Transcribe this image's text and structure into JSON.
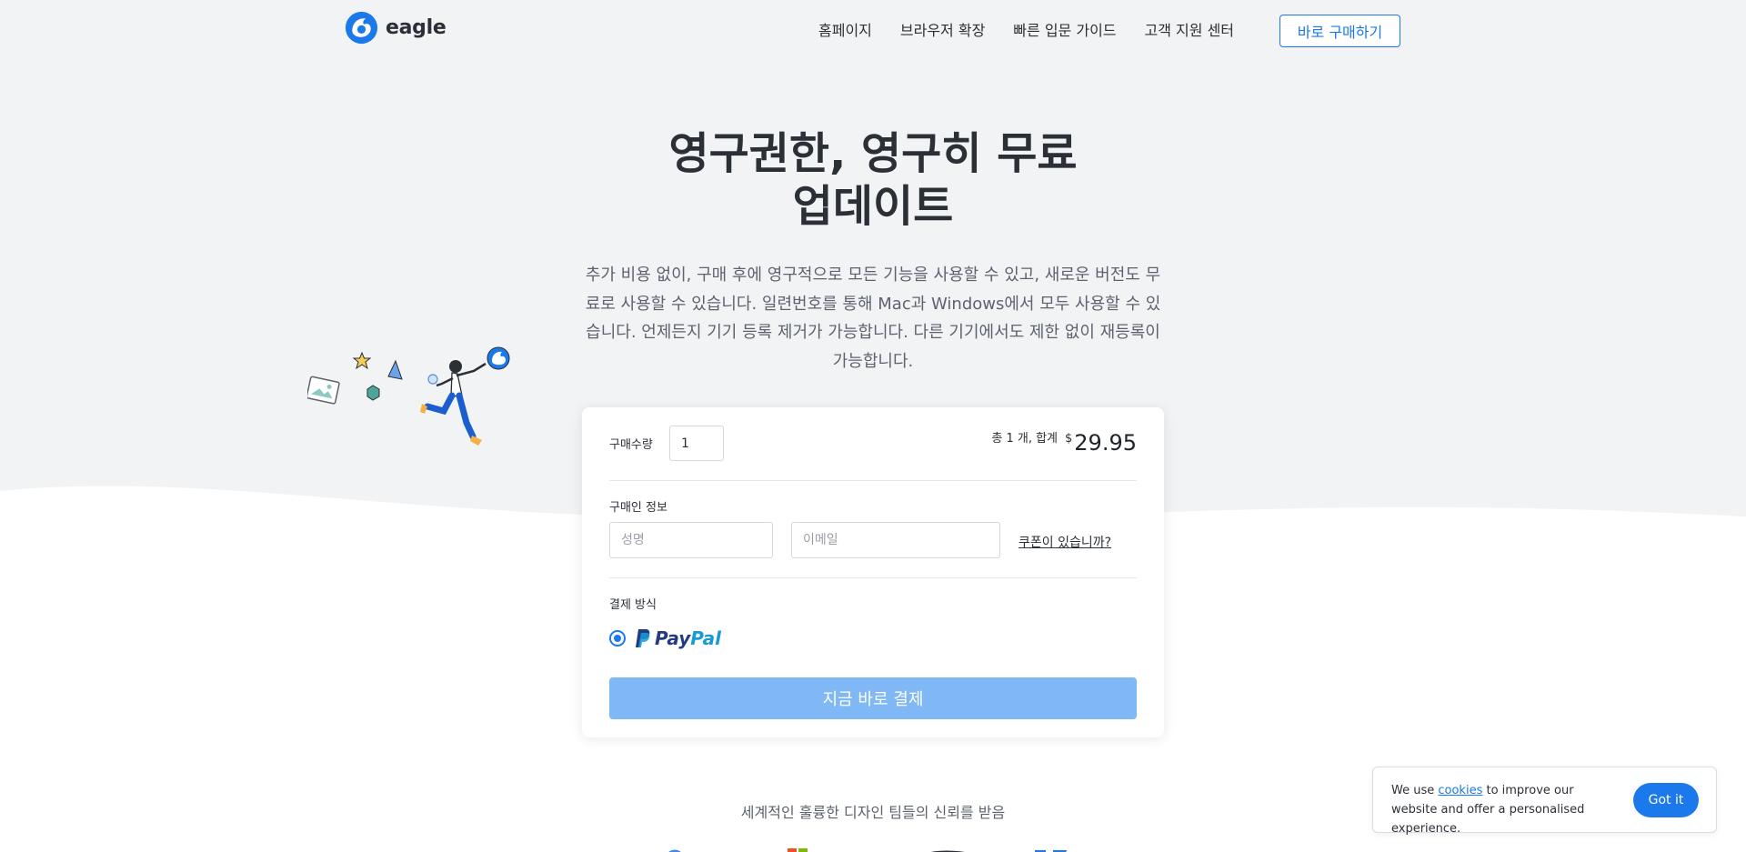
{
  "header": {
    "logo_text": "eagle",
    "nav": [
      "홈페이지",
      "브라우저 확장",
      "빠른 입문 가이드",
      "고객 지원 센터"
    ],
    "buy_button": "바로 구매하기"
  },
  "hero": {
    "title_line1": "영구권한, 영구히 무료",
    "title_line2": "업데이트",
    "subtitle": "추가 비용 없이, 구매 후에 영구적으로 모든 기능을 사용할 수 있고, 새로운 버전도 무료로 사용할 수 있습니다. 일련번호를 통해 Mac과 Windows에서 모두 사용할 수 있습니다. 언제든지 기기 등록 제거가 가능합니다. 다른 기기에서도 제한 없이 재등록이 가능합니다."
  },
  "purchase": {
    "quantity_label": "구매수량",
    "quantity_value": "1",
    "summary_text": "총 1 개, 합계",
    "currency": "$",
    "total": "29.95",
    "buyer_label": "구매인 정보",
    "name_placeholder": "성명",
    "email_placeholder": "이메일",
    "coupon_link": "쿠폰이 있습니까?",
    "payment_label": "결제 방식",
    "payment_option_pay": "Pay",
    "payment_option_pal": "Pal",
    "pay_button": "지금 바로 결제"
  },
  "trusted": {
    "text": "세계적인 훌륭한 디자인 팀들의 신뢰를 받음"
  },
  "cookie": {
    "text_before": "We use ",
    "link": "cookies",
    "text_after": " to improve our website and offer a personalised experience.",
    "button": "Got it"
  },
  "colors": {
    "accent": "#1b79ec",
    "hero_bg": "#f2f3f5",
    "pay_button_disabled": "#7fb8f4",
    "paypal_dark": "#253b80",
    "paypal_light": "#179bd7"
  }
}
